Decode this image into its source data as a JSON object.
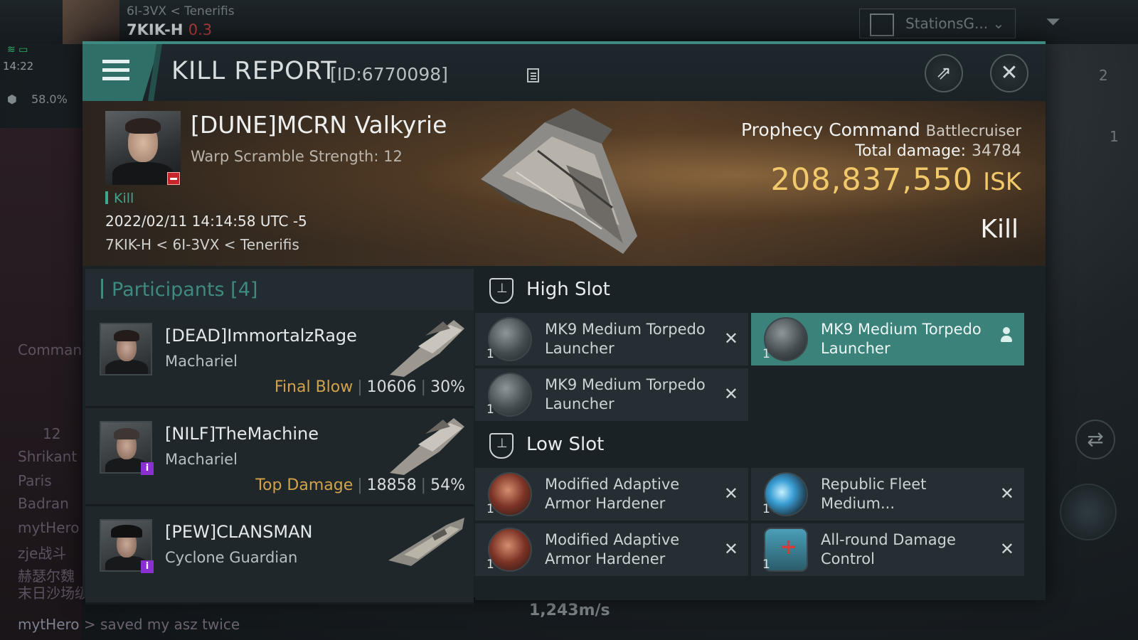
{
  "hud": {
    "location_path": "6I-3VX < Tenerifis",
    "system": "7KIK-H",
    "security": "0.3",
    "time": "14:22",
    "cargo_pct": "58.0%",
    "station_selector": "StationsG...",
    "counter_a": "2",
    "counter_b": "1",
    "speed": "1,243m/s",
    "chat": {
      "lines": [
        "Comman",
        "12",
        "Shrikant",
        "Paris",
        "Badran",
        "mytHero",
        "zje战斗",
        "赫瑟尔魏",
        "末日沙场级]"
      ],
      "last_author": "mytHero",
      "last_message": "> saved my asz twice"
    }
  },
  "report": {
    "title": "KILL REPORT",
    "id": "[ID:6770098]",
    "victim": {
      "name": "[DUNE]MCRN Valkyrie",
      "detail": "Warp Scramble Strength: 12",
      "tag": "Kill",
      "datetime": "2022/02/11 14:14:58 UTC -5",
      "location": "7KIK-H < 6I-3VX < Tenerifis"
    },
    "ship": {
      "name": "Prophecy Command",
      "class": "Battlecruiser",
      "total_damage_label": "Total damage:",
      "total_damage": "34784",
      "isk_value": "208,837,550",
      "isk_unit": "ISK",
      "result": "Kill"
    },
    "participants": {
      "header": "Participants [4]",
      "rows": [
        {
          "name": "[DEAD]ImmortalzRage",
          "ship": "Machariel",
          "tag": "Final Blow",
          "damage": "10606",
          "pct": "30%",
          "badge": false
        },
        {
          "name": "[NILF]TheMachine",
          "ship": "Machariel",
          "tag": "Top Damage",
          "damage": "18858",
          "pct": "54%",
          "badge": true
        },
        {
          "name": "[PEW]CLANSMAN",
          "ship": "Cyclone Guardian",
          "tag": "",
          "damage": "",
          "pct": "",
          "badge": true
        }
      ]
    },
    "fitting": {
      "high_slot_label": "High Slot",
      "low_slot_label": "Low Slot",
      "high": [
        {
          "name": "MK9 Medium Torpedo Launcher",
          "qty": "1",
          "icon": "torpedo-launcher-icon"
        },
        {
          "name": "MK9 Medium Torpedo Launcher",
          "qty": "1",
          "icon": "torpedo-launcher-icon"
        },
        {
          "name": "MK9 Medium Torpedo Launcher",
          "qty": "1",
          "icon": "torpedo-launcher-icon"
        }
      ],
      "low": [
        {
          "name": "Modified Adaptive Armor Hardener",
          "qty": "1",
          "icon": "armor-hardener-icon"
        },
        {
          "name": "Republic Fleet Medium...",
          "qty": "1",
          "icon": "republic-fleet-module-icon"
        },
        {
          "name": "Modified Adaptive Armor Hardener",
          "qty": "1",
          "icon": "armor-hardener-icon"
        },
        {
          "name": "All-round Damage Control",
          "qty": "1",
          "icon": "damage-control-icon"
        }
      ]
    }
  },
  "colors": {
    "accent": "#3f8a80",
    "isk": "#f1c86a",
    "tag": "#d2a24b",
    "victim_badge": "#c8262b",
    "info_badge": "#8a2fd0"
  }
}
